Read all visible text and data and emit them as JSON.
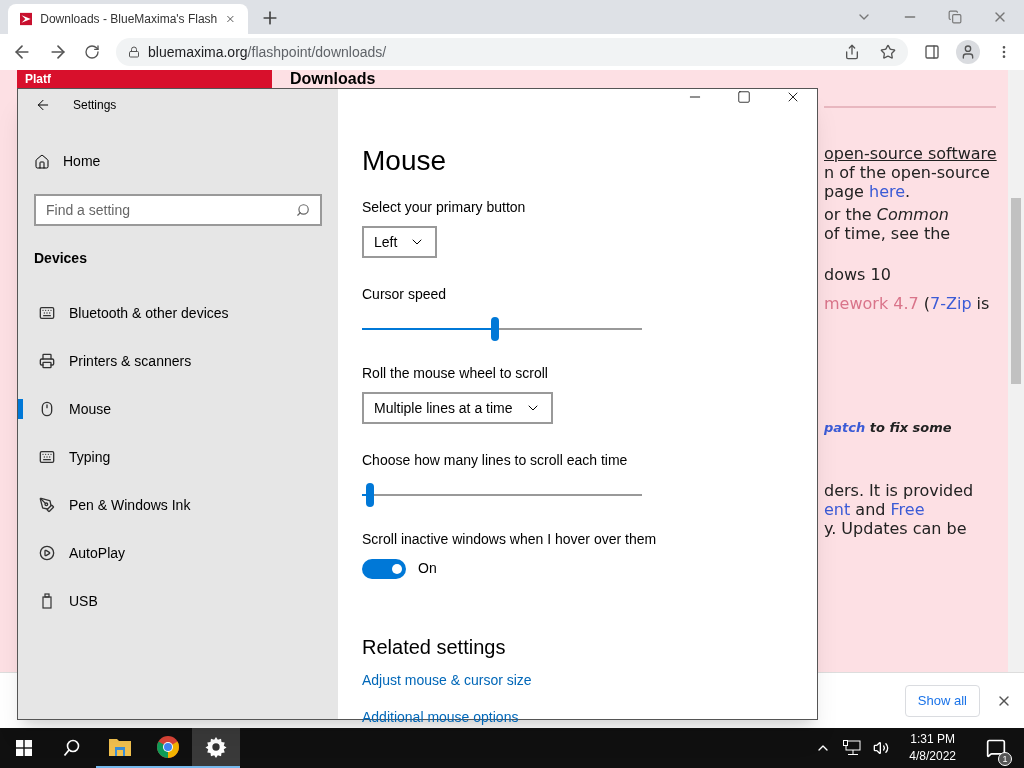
{
  "browser": {
    "tab": {
      "title": "Downloads - BlueMaxima's Flash",
      "selected": true
    },
    "url_domain": "bluemaxima.org",
    "url_path": "/flashpoint/downloads/"
  },
  "page": {
    "sidebar_title": "Platf",
    "heading": "Downloads",
    "lines": [
      [
        {
          "text": "open-source software",
          "kind": "underline"
        }
      ],
      [
        {
          "text": "n of the open-source",
          "kind": "plain"
        }
      ],
      [
        {
          "text": "page ",
          "kind": "plain"
        },
        {
          "text": "here",
          "kind": "link"
        },
        {
          "text": ".",
          "kind": "plain"
        }
      ],
      [
        {
          "text": "or the ",
          "kind": "plain"
        },
        {
          "text": "Common",
          "kind": "italic"
        }
      ],
      [
        {
          "text": "of time, see the",
          "kind": "plain"
        }
      ],
      [
        {
          "text": "dows 10",
          "kind": "plain"
        }
      ],
      [
        {
          "text": "mework 4.7",
          "kind": "visited"
        },
        {
          "text": " (",
          "kind": "plain"
        },
        {
          "text": "7-Zip",
          "kind": "link"
        },
        {
          "text": " is",
          "kind": "plain"
        }
      ],
      [
        {
          "text": "patch",
          "kind": "bold-link"
        },
        {
          "text": " to fix some",
          "kind": "bold-italic"
        }
      ],
      [
        {
          "text": "ders. It is provided",
          "kind": "plain"
        }
      ],
      [
        {
          "text": "ent",
          "kind": "link"
        },
        {
          "text": " and ",
          "kind": "plain"
        },
        {
          "text": "Free",
          "kind": "link"
        }
      ],
      [
        {
          "text": "y. Updates can be",
          "kind": "plain"
        }
      ]
    ]
  },
  "settings": {
    "title": "Settings",
    "home": "Home",
    "search": {
      "placeholder": "Find a setting"
    },
    "section": "Devices",
    "nav": [
      {
        "label": "Bluetooth & other devices",
        "selected": false
      },
      {
        "label": "Printers & scanners",
        "selected": false
      },
      {
        "label": "Mouse",
        "selected": true
      },
      {
        "label": "Typing",
        "selected": false
      },
      {
        "label": "Pen & Windows Ink",
        "selected": false
      },
      {
        "label": "AutoPlay",
        "selected": false
      },
      {
        "label": "USB",
        "selected": false
      }
    ],
    "page_title": "Mouse",
    "controls": [
      {
        "kind": "dropdown",
        "label": "Select your primary button",
        "value": "Left"
      },
      {
        "kind": "slider",
        "label": "Cursor speed",
        "level": 0.475
      },
      {
        "kind": "dropdown",
        "label": "Roll the mouse wheel to scroll",
        "value": "Multiple lines at a time"
      },
      {
        "kind": "slider",
        "label": "Choose how many lines to scroll each time",
        "level": 0.03
      },
      {
        "kind": "toggle",
        "label": "Scroll inactive windows when I hover over them",
        "on": true,
        "state_text": "On"
      }
    ],
    "related_title": "Related settings",
    "related_links": [
      "Adjust mouse & cursor size",
      "Additional mouse options"
    ]
  },
  "download_bar": {
    "show_all": "Show all"
  },
  "taskbar": {
    "items": [
      {
        "selected": false
      },
      {
        "selected": false
      },
      {
        "selected": true
      }
    ],
    "time": "1:31 PM",
    "date": "4/8/2022",
    "notifications": "1"
  }
}
